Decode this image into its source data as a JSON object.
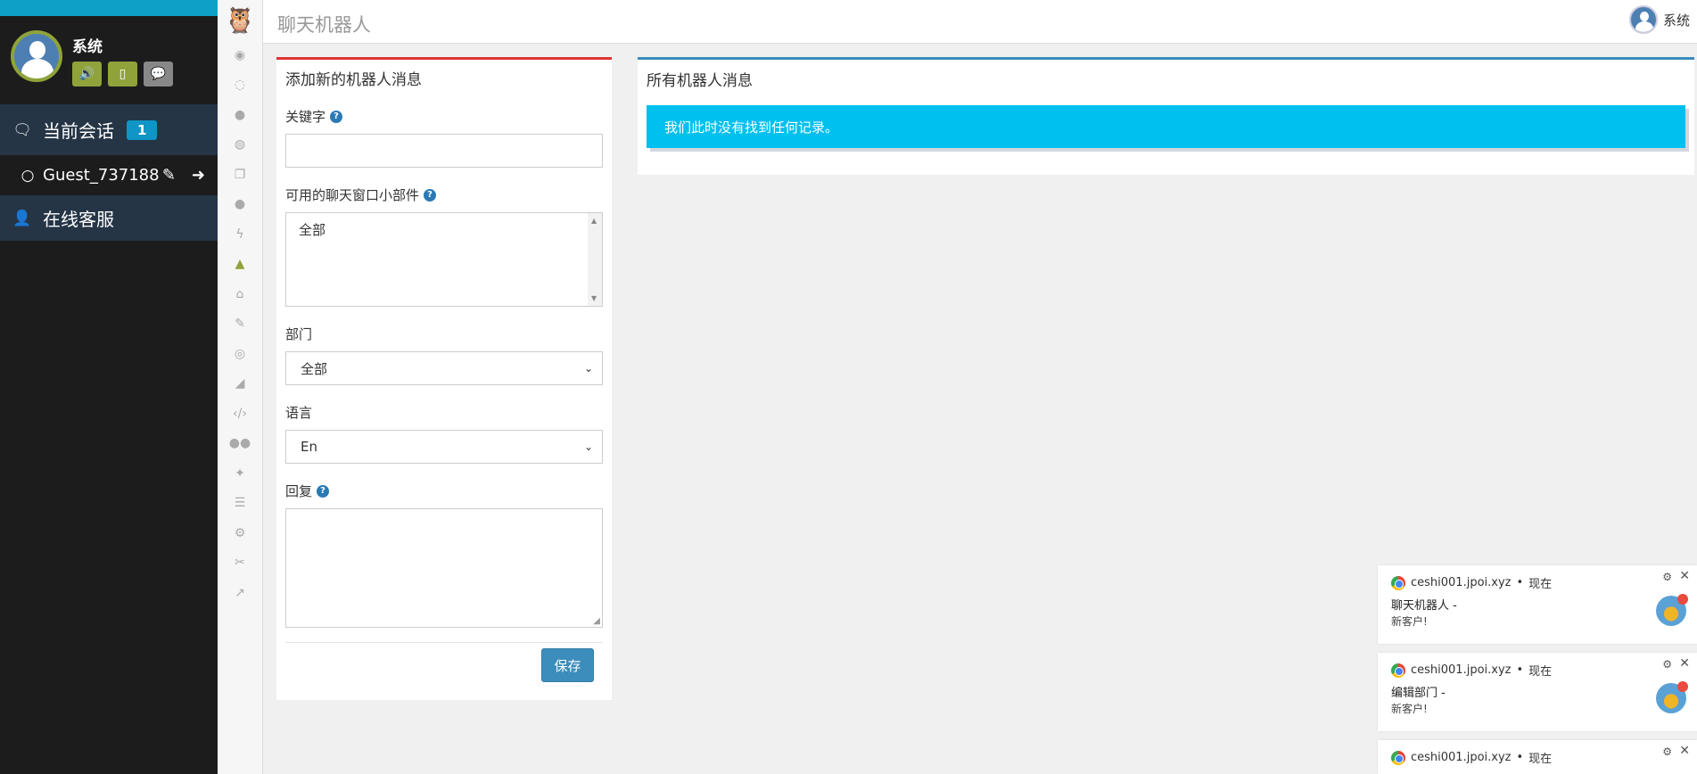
{
  "sidebar": {
    "user_name": "系统",
    "current_sessions_label": "当前会话",
    "current_sessions_count": "1",
    "guest_name": "Guest_737188",
    "online_support_label": "在线客服"
  },
  "header": {
    "title": "聊天机器人",
    "user_name": "系统"
  },
  "form": {
    "title": "添加新的机器人消息",
    "keyword_label": "关键字",
    "widgets_label": "可用的聊天窗口小部件",
    "widgets_option": "全部",
    "department_label": "部门",
    "department_value": "全部",
    "language_label": "语言",
    "language_value": "En",
    "reply_label": "回复",
    "save_label": "保存"
  },
  "list": {
    "title": "所有机器人消息",
    "empty_message": "我们此时没有找到任何记录。"
  },
  "notifications": [
    {
      "source": "ceshi001.jpoi.xyz",
      "time": "现在",
      "title": "聊天机器人 -",
      "body": "新客户!"
    },
    {
      "source": "ceshi001.jpoi.xyz",
      "time": "现在",
      "title": "编辑部门 -",
      "body": "新客户!"
    },
    {
      "source": "ceshi001.jpoi.xyz",
      "time": "现在",
      "title": "",
      "body": ""
    }
  ],
  "colors": {
    "sidebar_bg": "#1c1c1c",
    "nav_active_bg": "#253546",
    "accent_green": "#8fa33a",
    "badge_blue": "#0f95c6",
    "alert_cyan": "#00c0ef",
    "form_border_red": "#dd3333",
    "list_border_blue": "#3c8dbc"
  },
  "icons": {
    "rail": [
      "eye-icon",
      "comments-icon",
      "comment-dots-icon",
      "comments-alt-icon",
      "copy-icon",
      "comment-icon",
      "bolt-icon",
      "android-icon",
      "bank-icon",
      "pencil-icon",
      "user-circle-icon",
      "area-chart-icon",
      "code-icon",
      "users-icon",
      "magic-icon",
      "list-alt-icon",
      "gear-icon",
      "wrench-icon",
      "line-chart-icon"
    ]
  }
}
